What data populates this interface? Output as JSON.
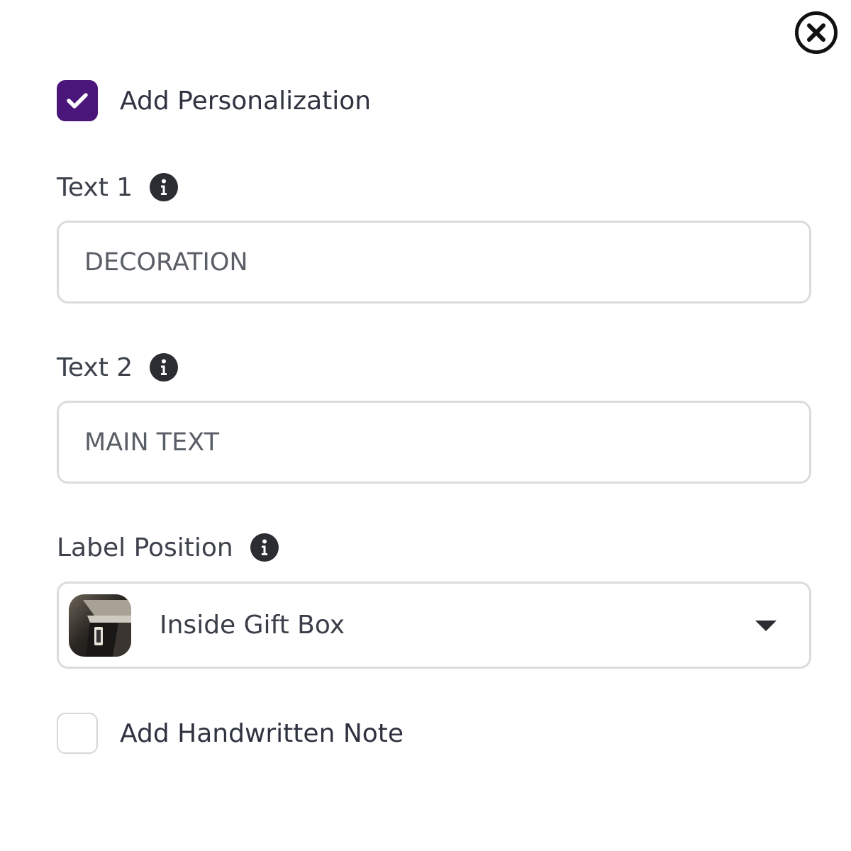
{
  "icons": {
    "close": "close-circle-icon",
    "check": "checkmark-icon",
    "info": "info-icon",
    "caret": "caret-down-icon",
    "thumbnail": "gift-box-thumbnail"
  },
  "colors": {
    "accent": "#4a167a",
    "checkmark": "#ffffff",
    "text": "#2f3340",
    "border": "#dcdce0"
  },
  "personalization": {
    "checkbox_label": "Add Personalization",
    "checked": true
  },
  "fields": [
    {
      "label": "Text 1",
      "placeholder": "DECORATION",
      "value": ""
    },
    {
      "label": "Text 2",
      "placeholder": "MAIN TEXT",
      "value": ""
    }
  ],
  "label_position": {
    "label": "Label Position",
    "selected": "Inside Gift Box"
  },
  "handwritten_note": {
    "checkbox_label": "Add Handwritten Note",
    "checked": false
  }
}
